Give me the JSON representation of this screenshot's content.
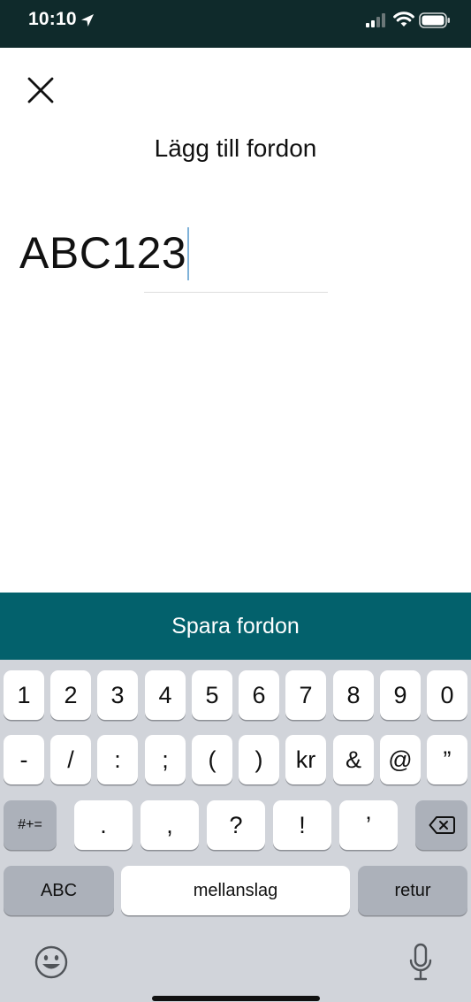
{
  "status_bar": {
    "time": "10:10"
  },
  "header": {
    "title": "Lägg till fordon"
  },
  "plate_input": {
    "value": "ABC123"
  },
  "save_button": {
    "label": "Spara fordon"
  },
  "keyboard": {
    "row1": [
      "1",
      "2",
      "3",
      "4",
      "5",
      "6",
      "7",
      "8",
      "9",
      "0"
    ],
    "row2": [
      "-",
      "/",
      ":",
      ";",
      "(",
      ")",
      "kr",
      "&",
      "@",
      "”"
    ],
    "row3_mode": "#+=",
    "row3": [
      ".",
      ",",
      "?",
      "!",
      "’"
    ],
    "abc_key": "ABC",
    "space_key": "mellanslag",
    "return_key": "retur"
  },
  "icons": [
    "location-arrow-icon",
    "cellular-signal-icon",
    "wifi-icon",
    "battery-icon",
    "close-icon",
    "backspace-icon",
    "emoji-icon",
    "microphone-icon"
  ],
  "colors": {
    "status_bar_bg": "#0f2a2b",
    "accent": "#03616c",
    "keyboard_bg": "#d1d4da",
    "caret": "#7fb2d9"
  }
}
